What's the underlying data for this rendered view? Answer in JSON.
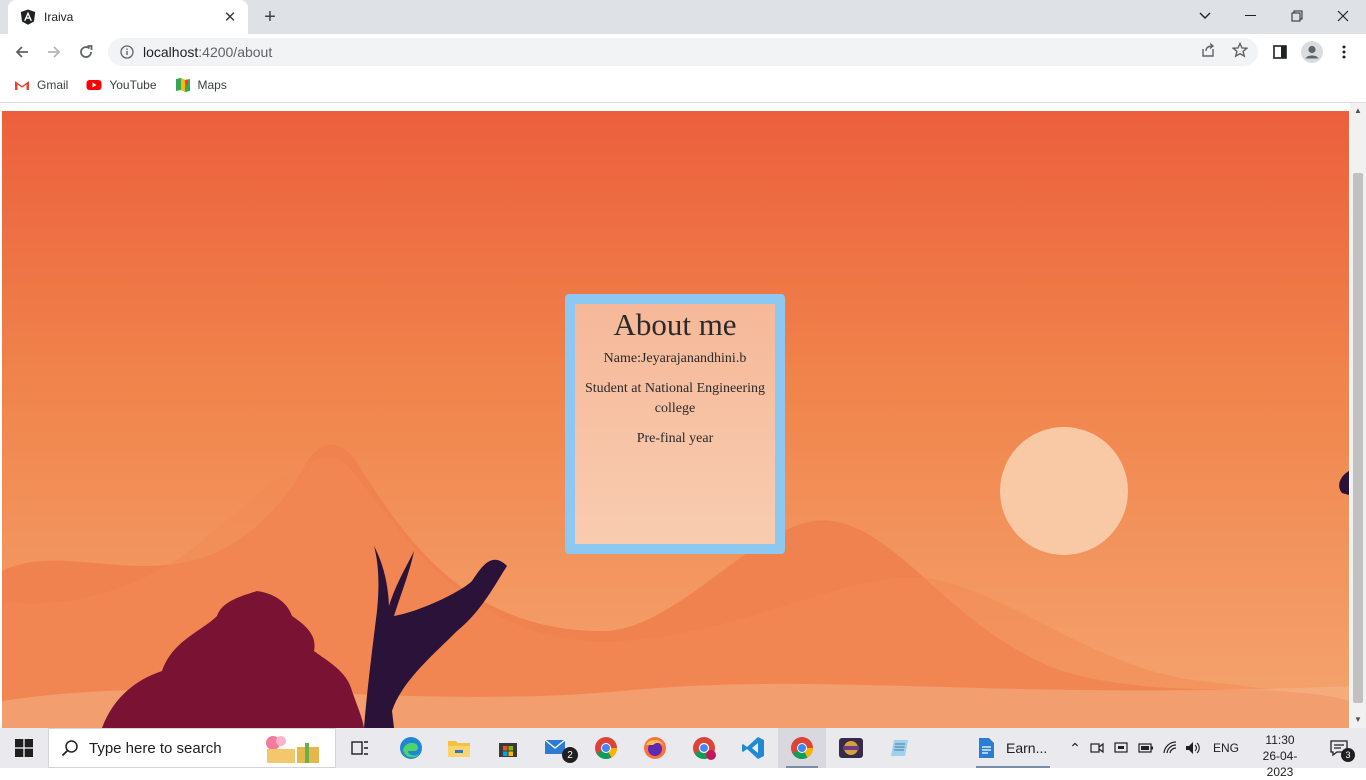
{
  "browser": {
    "tab_title": "Iraiva",
    "url_host": "localhost",
    "url_path": ":4200/about",
    "bookmarks": [
      {
        "label": "Gmail",
        "icon": "gmail-icon"
      },
      {
        "label": "YouTube",
        "icon": "youtube-icon"
      },
      {
        "label": "Maps",
        "icon": "maps-icon"
      }
    ]
  },
  "page": {
    "card": {
      "title": "About me",
      "name_line": "Name:Jeyarajanandhini.b",
      "student_line": "Student at National Engineering college",
      "year_line": "Pre-final year"
    }
  },
  "taskbar": {
    "search_placeholder": "Type here to search",
    "mail_badge": "2",
    "word_app_label": "Earn...",
    "language": "ENG",
    "time": "11:30",
    "date": "26-04-2023",
    "notification_count": "3"
  },
  "colors": {
    "sky_top": "#ec5f3d",
    "sky_bottom": "#f5a470",
    "card_border": "#8dc8f0",
    "card_fill": "#f7c0a2",
    "sun": "#f9c9a6",
    "hill_light": "#f6b58a",
    "hill_mid": "#f0824f",
    "tree": "#7a1233",
    "antler": "#2a1238"
  }
}
